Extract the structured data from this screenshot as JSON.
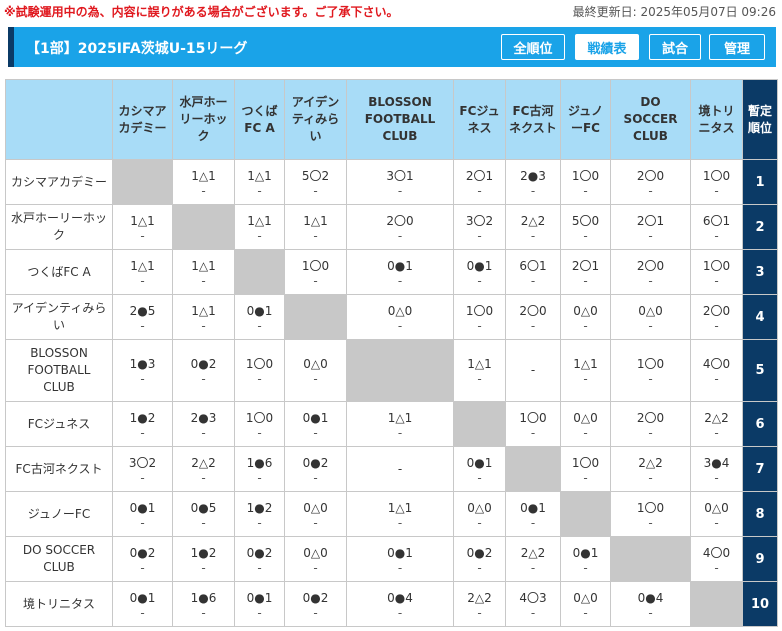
{
  "notice": "※試験運用中の為、内容に誤りがある場合がございます。ご了承下さい。",
  "updated": "最終更新日: 2025年05月07日 09:26",
  "header": {
    "title": "【1部】2025IFA茨城U-15リーグ",
    "buttons": [
      {
        "label": "全順位",
        "active": false
      },
      {
        "label": "戦績表",
        "active": true
      },
      {
        "label": "試合",
        "active": false
      },
      {
        "label": "管理",
        "active": false
      }
    ]
  },
  "table": {
    "rank_header": "暫定順位",
    "columns": [
      "カシマアカデミー",
      "水戸ホーリーホック",
      "つくばFC A",
      "アイデンティみらい",
      "BLOSSON FOOTBALL CLUB",
      "FCジュネス",
      "FC古河ネクスト",
      "ジュノーFC",
      "DO SOCCER CLUB",
      "境トリニタス"
    ],
    "rows": [
      {
        "team": "カシマアカデミー",
        "rank": "1",
        "cells": [
          null,
          "1△1",
          "1△1",
          "5〇2",
          "3〇1",
          "2〇1",
          "2●3",
          "1〇0",
          "2〇0",
          "1〇0"
        ]
      },
      {
        "team": "水戸ホーリーホック",
        "rank": "2",
        "cells": [
          "1△1",
          null,
          "1△1",
          "1△1",
          "2〇0",
          "3〇2",
          "2△2",
          "5〇0",
          "2〇1",
          "6〇1"
        ]
      },
      {
        "team": "つくばFC A",
        "rank": "3",
        "cells": [
          "1△1",
          "1△1",
          null,
          "1〇0",
          "0●1",
          "0●1",
          "6〇1",
          "2〇1",
          "2〇0",
          "1〇0"
        ]
      },
      {
        "team": "アイデンティみらい",
        "rank": "4",
        "cells": [
          "2●5",
          "1△1",
          "0●1",
          null,
          "0△0",
          "1〇0",
          "2〇0",
          "0△0",
          "0△0",
          "2〇0"
        ]
      },
      {
        "team": "BLOSSON FOOTBALL CLUB",
        "rank": "5",
        "cells": [
          "1●3",
          "0●2",
          "1〇0",
          "0△0",
          null,
          "1△1",
          "-",
          "1△1",
          "1〇0",
          "4〇0"
        ]
      },
      {
        "team": "FCジュネス",
        "rank": "6",
        "cells": [
          "1●2",
          "2●3",
          "1〇0",
          "0●1",
          "1△1",
          null,
          "1〇0",
          "0△0",
          "2〇0",
          "2△2"
        ]
      },
      {
        "team": "FC古河ネクスト",
        "rank": "7",
        "cells": [
          "3〇2",
          "2△2",
          "1●6",
          "0●2",
          "-",
          "0●1",
          null,
          "1〇0",
          "2△2",
          "3●4"
        ]
      },
      {
        "team": "ジュノーFC",
        "rank": "8",
        "cells": [
          "0●1",
          "0●5",
          "1●2",
          "0△0",
          "1△1",
          "0△0",
          "0●1",
          null,
          "1〇0",
          "0△0"
        ]
      },
      {
        "team": "DO SOCCER CLUB",
        "rank": "9",
        "cells": [
          "0●2",
          "1●2",
          "0●2",
          "0△0",
          "0●1",
          "0●2",
          "2△2",
          "0●1",
          null,
          "4〇0"
        ]
      },
      {
        "team": "境トリニタス",
        "rank": "10",
        "cells": [
          "0●1",
          "1●6",
          "0●1",
          "0●2",
          "0●4",
          "2△2",
          "4〇3",
          "0△0",
          "0●4",
          null
        ]
      }
    ],
    "sub_marker": "-"
  }
}
